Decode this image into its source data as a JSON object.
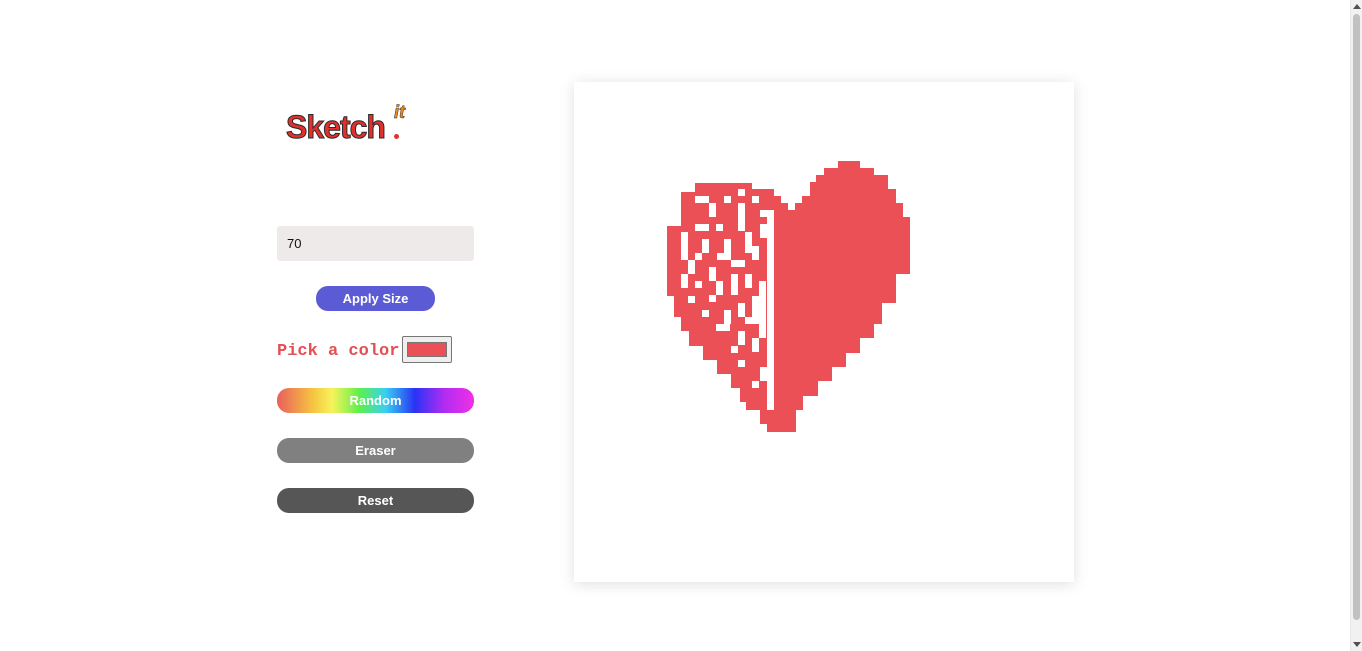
{
  "brand": {
    "logo_text": "Sketch",
    "logo_suffix": "it"
  },
  "controls": {
    "grid_size_value": "70",
    "apply_label": "Apply Size",
    "pick_color_label": "Pick a color",
    "selected_color": "#eb5056",
    "random_label": "Random",
    "eraser_label": "Eraser",
    "reset_label": "Reset"
  },
  "drawing": {
    "grid_size": 70,
    "paint_color": "#eb5056",
    "background_color": "#ffffff"
  }
}
